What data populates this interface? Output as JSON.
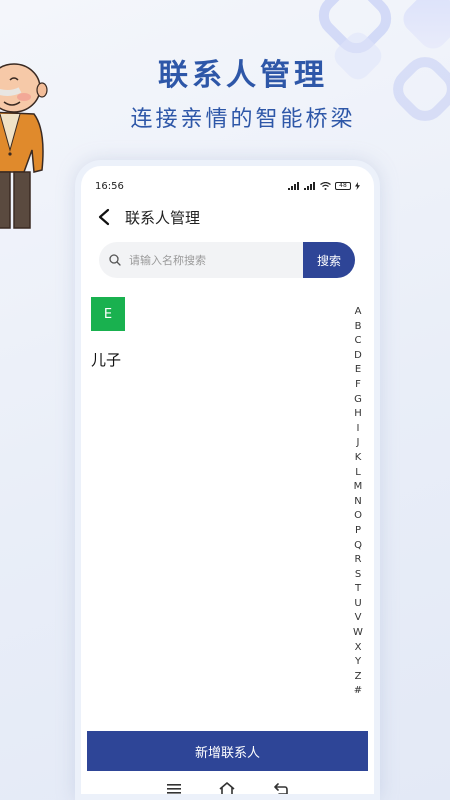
{
  "promo": {
    "title": "联系人管理",
    "subtitle": "连接亲情的智能桥梁"
  },
  "status_bar": {
    "time": "16:56",
    "battery": "48"
  },
  "header": {
    "back_icon": "chevron-left-icon",
    "title": "联系人管理"
  },
  "search": {
    "placeholder": "请输入名称搜索",
    "button_label": "搜索"
  },
  "contacts": {
    "group_letter": "E",
    "group_color": "#19b14f",
    "items": [
      "儿子"
    ]
  },
  "index_letters": [
    "A",
    "B",
    "C",
    "D",
    "E",
    "F",
    "G",
    "H",
    "I",
    "J",
    "K",
    "L",
    "M",
    "N",
    "O",
    "P",
    "Q",
    "R",
    "S",
    "T",
    "U",
    "V",
    "W",
    "X",
    "Y",
    "Z",
    "#"
  ],
  "footer": {
    "add_button": "新增联系人"
  },
  "colors": {
    "accent": "#2e4597",
    "promo_text": "#2e57a8"
  }
}
